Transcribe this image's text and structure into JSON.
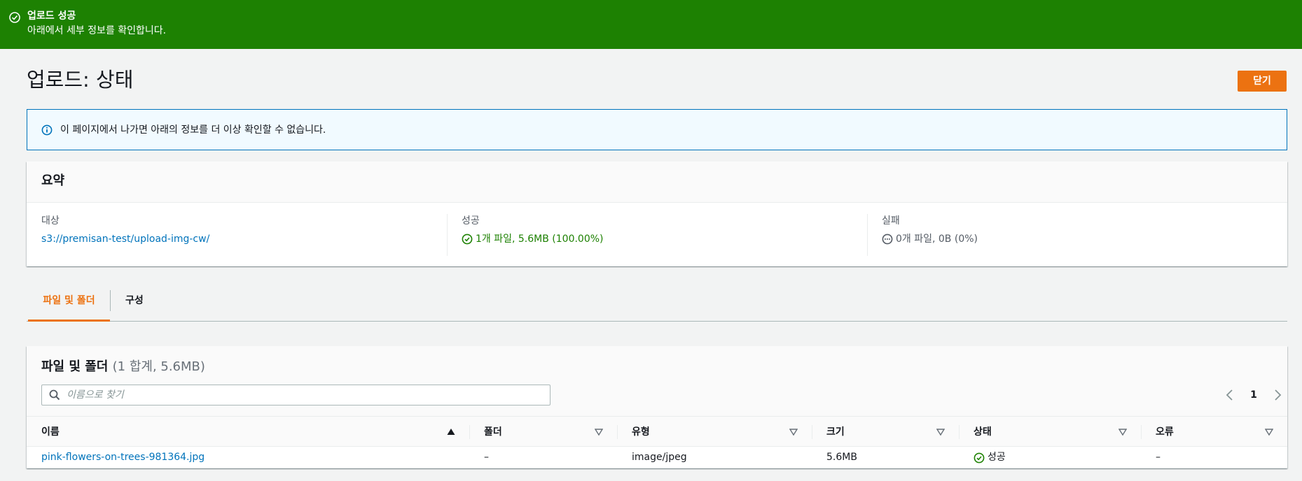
{
  "flash": {
    "title": "업로드 성공",
    "message": "아래에서 세부 정보를 확인합니다.",
    "icon": "success-circle-icon",
    "color": "#1d8102"
  },
  "header": {
    "title": "업로드: 상태",
    "close_label": "닫기",
    "accent": "#ec7211"
  },
  "info": {
    "text": "이 페이지에서 나가면 아래의 정보를 더 이상 확인할 수 없습니다.",
    "icon": "info-circle-icon"
  },
  "summary": {
    "title": "요약",
    "destination_label": "대상",
    "destination_value": "s3://premisan-test/upload-img-cw/",
    "success_label": "성공",
    "success_value": "1개 파일, 5.6MB (100.00%)",
    "failed_label": "실패",
    "failed_value": "0개 파일, 0B (0%)"
  },
  "tabs": [
    {
      "label": "파일 및 폴더",
      "active": true
    },
    {
      "label": "구성",
      "active": false
    }
  ],
  "files_panel": {
    "title": "파일 및 폴더",
    "count": "(1 합계, 5.6MB)",
    "search_placeholder": "이름으로 찾기",
    "page_number": "1",
    "columns": [
      "이름",
      "폴더",
      "유형",
      "크기",
      "상태",
      "오류"
    ],
    "rows": [
      {
        "name": "pink-flowers-on-trees-981364.jpg",
        "folder": "–",
        "type": "image/jpeg",
        "size": "5.6MB",
        "status": "성공",
        "error": "–"
      }
    ]
  }
}
